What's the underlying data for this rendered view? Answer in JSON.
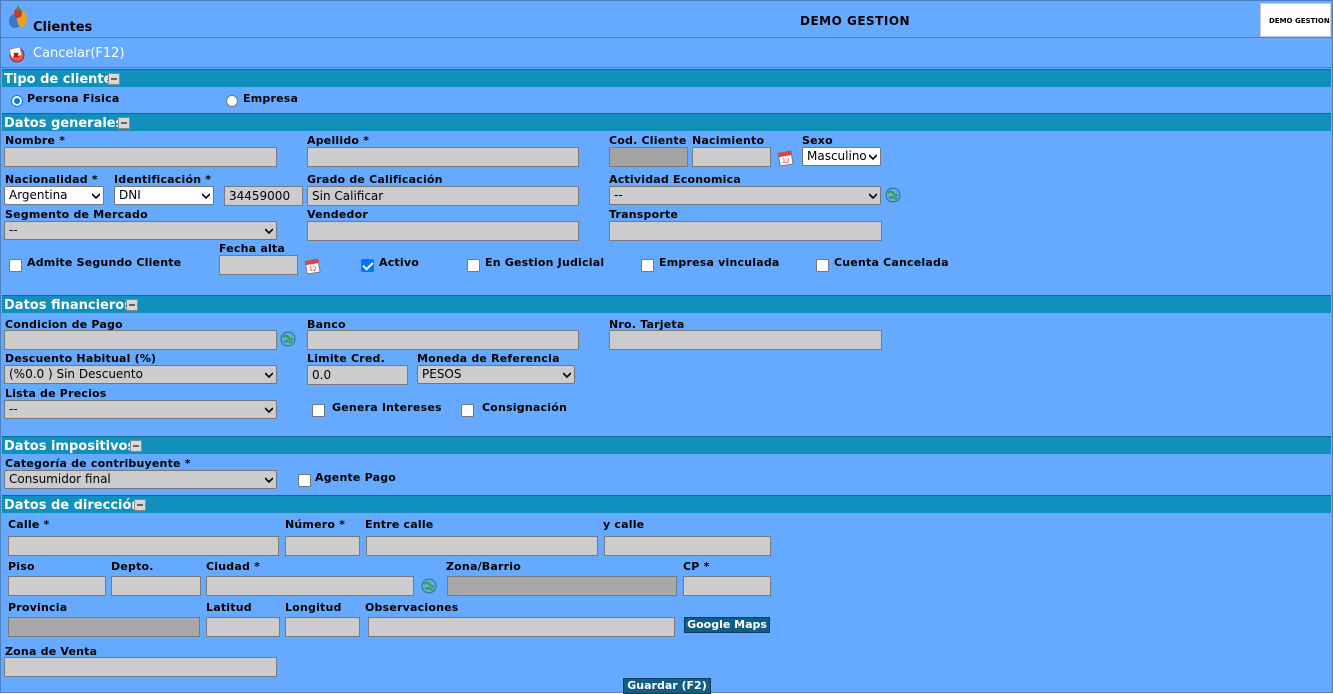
{
  "header": {
    "title": "Clientes",
    "company": "DEMO GESTION",
    "logo_text": "DEMO GESTION"
  },
  "toolbar": {
    "cancel_label": "Cancelar(F12)"
  },
  "tipo_cliente": {
    "section_title": "Tipo de cliente",
    "opt_persona": "Persona Fisica",
    "opt_empresa": "Empresa",
    "selected": "Persona Fisica"
  },
  "datos_generales": {
    "section_title": "Datos generales",
    "nombre_label": "Nombre *",
    "nombre_value": "",
    "apellido_label": "Apellido *",
    "apellido_value": "",
    "cod_cliente_label": "Cod. Cliente",
    "cod_cliente_value": "",
    "nacimiento_label": "Nacimiento",
    "nacimiento_value": "",
    "sexo_label": "Sexo",
    "sexo_value": "Masculino",
    "nacionalidad_label": "Nacionalidad *",
    "nacionalidad_value": "Argentina",
    "identificacion_label": "Identificación *",
    "identificacion_tipo": "DNI",
    "identificacion_numero": "34459000",
    "calificacion_label": "Grado de Calificación",
    "calificacion_value": "Sin Calificar",
    "actividad_label": "Actividad Economica",
    "actividad_value": "--",
    "segmento_label": "Segmento de Mercado",
    "segmento_value": "--",
    "vendedor_label": "Vendedor",
    "vendedor_value": "",
    "transporte_label": "Transporte",
    "transporte_value": "",
    "fecha_alta_label": "Fecha alta",
    "fecha_alta_value": "",
    "admite_label": "Admite Segundo Cliente",
    "admite_checked": false,
    "activo_label": "Activo",
    "activo_checked": true,
    "judicial_label": "En Gestion Judicial",
    "judicial_checked": false,
    "vinculada_label": "Empresa vinculada",
    "vinculada_checked": false,
    "cancelada_label": "Cuenta Cancelada",
    "cancelada_checked": false
  },
  "datos_financieros": {
    "section_title": "Datos financieros",
    "condicion_label": "Condicion de Pago",
    "condicion_value": "",
    "banco_label": "Banco",
    "banco_value": "",
    "tarjeta_label": "Nro. Tarjeta",
    "tarjeta_value": "",
    "descuento_label": "Descuento Habitual (%)",
    "descuento_value": "(%0.0 ) Sin Descuento",
    "limite_label": "Limite Cred.",
    "limite_value": "0.0",
    "moneda_label": "Moneda de Referencia",
    "moneda_value": "PESOS",
    "lista_label": "Lista de Precios",
    "lista_value": "--",
    "intereses_label": "Genera Intereses",
    "intereses_checked": false,
    "consignacion_label": "Consignación",
    "consignacion_checked": false
  },
  "datos_impositivos": {
    "section_title": "Datos impositivos",
    "categoria_label": "Categoría de contribuyente *",
    "categoria_value": "Consumidor final",
    "agente_label": "Agente Pago",
    "agente_checked": false
  },
  "datos_direccion": {
    "section_title": "Datos de dirección",
    "calle_label": "Calle *",
    "calle_value": "",
    "numero_label": "Número *",
    "numero_value": "",
    "entre_label": "Entre calle",
    "entre_value": "",
    "ycalle_label": "y calle",
    "ycalle_value": "",
    "piso_label": "Piso",
    "piso_value": "",
    "depto_label": "Depto.",
    "depto_value": "",
    "ciudad_label": "Ciudad *",
    "ciudad_value": "",
    "zona_label": "Zona/Barrio",
    "zona_value": "",
    "cp_label": "CP *",
    "cp_value": "",
    "provincia_label": "Provincia",
    "provincia_value": "",
    "latitud_label": "Latitud",
    "latitud_value": "",
    "longitud_label": "Longitud",
    "longitud_value": "",
    "observaciones_label": "Observaciones",
    "observaciones_value": "",
    "maps_label": "Google Maps",
    "zona_venta_label": "Zona de Venta",
    "zona_venta_value": ""
  },
  "footer": {
    "save_label": "Guardar (F2)"
  },
  "colors": {
    "background": "#66aaff",
    "section": "#118fbd",
    "button": "#125d86",
    "input": "#cccccc"
  }
}
